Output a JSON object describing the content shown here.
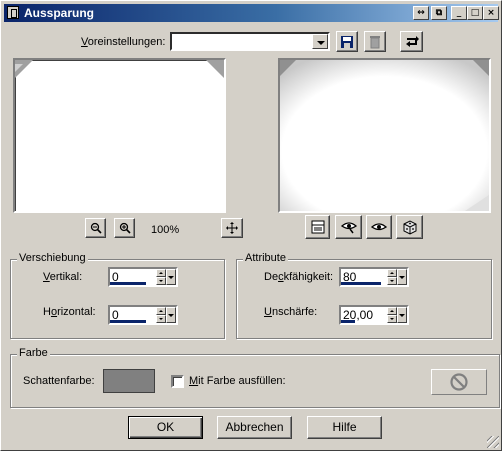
{
  "window": {
    "title": "Aussparung"
  },
  "titlebar_buttons": [
    {
      "name": "pin",
      "glyph": "↔"
    },
    {
      "name": "restore-small",
      "glyph": "⧉"
    },
    {
      "name": "minimize",
      "glyph": "_"
    },
    {
      "name": "maximize",
      "glyph": "□"
    },
    {
      "name": "close",
      "glyph": "×"
    }
  ],
  "presets": {
    "label_u": "V",
    "label_rest": "oreinstellungen:",
    "value": "",
    "icons": {
      "save": "save-icon",
      "delete": "trash-icon",
      "reset": "reset-icon"
    }
  },
  "preview": {
    "zoom": "100%",
    "icons": {
      "zoom_out": "zoom-out-icon",
      "zoom_in": "zoom-in-icon",
      "pan": "move-icon"
    }
  },
  "tools": [
    "layout-icon",
    "eye-pick-icon",
    "eye-icon",
    "dice-icon"
  ],
  "offset": {
    "title": "Verschiebung",
    "vertical": {
      "label_u": "V",
      "label_rest": "ertikal:",
      "value": "0"
    },
    "horizontal": {
      "label_pre": "H",
      "label_u": "o",
      "label_rest": "rizontal:",
      "value": "0"
    }
  },
  "attributes": {
    "title": "Attribute",
    "opacity": {
      "label_pre": "De",
      "label_u": "c",
      "label_rest": "kfähigkeit:",
      "value": "80"
    },
    "blur": {
      "label_u": "U",
      "label_rest": "nschärfe:",
      "value": "20,00"
    }
  },
  "color": {
    "title": "Farbe",
    "shadow_label": "Schattenfarbe:",
    "shadow_color": "#808080",
    "fill_label_u": "M",
    "fill_label_rest": "it Farbe ausfüllen:",
    "fill_checked": false,
    "fill_color_state": "disabled"
  },
  "footer": {
    "ok": "OK",
    "cancel": "Abbrechen",
    "help": "Hilfe"
  }
}
